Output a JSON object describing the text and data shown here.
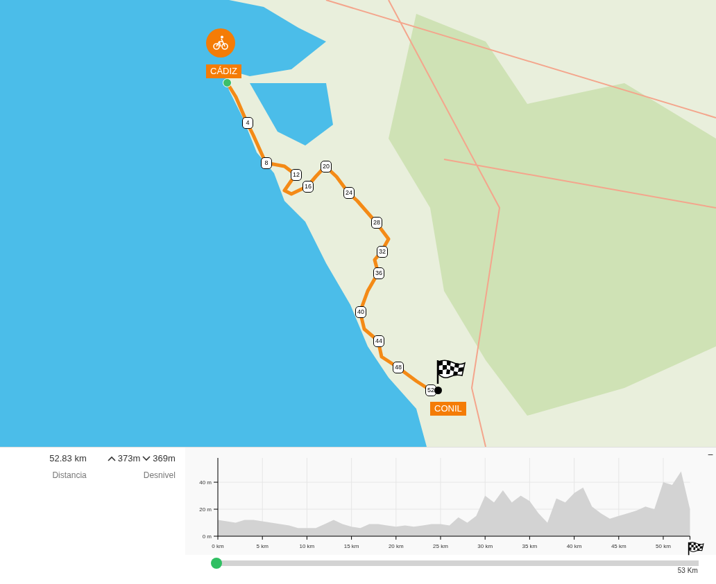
{
  "map": {
    "start_label": "CÁDIZ",
    "end_label": "CONIL",
    "km_markers": [
      "4",
      "8",
      "12",
      "16",
      "20",
      "24",
      "28",
      "32",
      "36",
      "40",
      "44",
      "48",
      "52"
    ]
  },
  "stats": {
    "distance": "52.83 km",
    "distance_label": "Distancia",
    "ascent": "373m",
    "descent": "369m",
    "elevation_label": "Desnivel"
  },
  "collapse_button": "−",
  "profile": {
    "chart_data": {
      "type": "area",
      "grid": true,
      "x": [
        0,
        1,
        2,
        3,
        4,
        5,
        6,
        7,
        8,
        9,
        10,
        11,
        12,
        13,
        14,
        15,
        16,
        17,
        18,
        19,
        20,
        21,
        22,
        23,
        24,
        25,
        26,
        27,
        28,
        29,
        30,
        31,
        32,
        33,
        34,
        35,
        36,
        37,
        38,
        39,
        40,
        41,
        42,
        43,
        44,
        45,
        46,
        47,
        48,
        49,
        50,
        51,
        52,
        53
      ],
      "series": [
        {
          "color": "#d3d3d3",
          "values": [
            12,
            11,
            10,
            12,
            12,
            11,
            10,
            9,
            8,
            6,
            6,
            6,
            9,
            12,
            9,
            7,
            6,
            9,
            9,
            8,
            7,
            8,
            7,
            8,
            9,
            9,
            8,
            14,
            10,
            15,
            30,
            25,
            34,
            25,
            30,
            26,
            17,
            10,
            28,
            25,
            32,
            36,
            22,
            17,
            13,
            15,
            17,
            19,
            22,
            20,
            40,
            38,
            48,
            20
          ]
        }
      ],
      "xlim": [
        0,
        53
      ],
      "ylim": [
        0,
        58
      ],
      "xticks": [
        {
          "value": 0,
          "label": "0 km"
        },
        {
          "value": 5,
          "label": "5 km"
        },
        {
          "value": 10,
          "label": "10 km"
        },
        {
          "value": 15,
          "label": "15 km"
        },
        {
          "value": 20,
          "label": "20 km"
        },
        {
          "value": 25,
          "label": "25 km"
        },
        {
          "value": 30,
          "label": "30 km"
        },
        {
          "value": 35,
          "label": "35 km"
        },
        {
          "value": 40,
          "label": "40 km"
        },
        {
          "value": 45,
          "label": "45 km"
        },
        {
          "value": 50,
          "label": "50 km"
        }
      ],
      "yticks": [
        {
          "value": 0,
          "label": "0 m"
        },
        {
          "value": 20,
          "label": "20 m"
        },
        {
          "value": 40,
          "label": "40 m"
        }
      ]
    }
  },
  "slider": {
    "level": 0,
    "end_label": "53 Km"
  }
}
